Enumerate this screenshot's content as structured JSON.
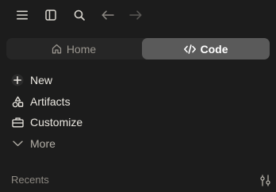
{
  "toolbar": {
    "icons": [
      "menu-icon",
      "sidebar-toggle-icon",
      "search-icon",
      "back-arrow-icon",
      "forward-arrow-icon"
    ]
  },
  "mode_switch": {
    "home_label": "Home",
    "code_label": "Code",
    "selected": "Code"
  },
  "nav": {
    "items": [
      {
        "label": "New",
        "icon": "plus-icon"
      },
      {
        "label": "Artifacts",
        "icon": "artifacts-icon"
      },
      {
        "label": "Customize",
        "icon": "briefcase-icon"
      },
      {
        "label": "More",
        "icon": "chevron-down-icon"
      }
    ]
  },
  "recents": {
    "label": "Recents"
  },
  "colors": {
    "background": "#1c1c1c",
    "switch_bg": "#262626",
    "switch_selected": "#5a5a5a",
    "text": "#ebe8e1",
    "muted": "#8e8a83"
  }
}
